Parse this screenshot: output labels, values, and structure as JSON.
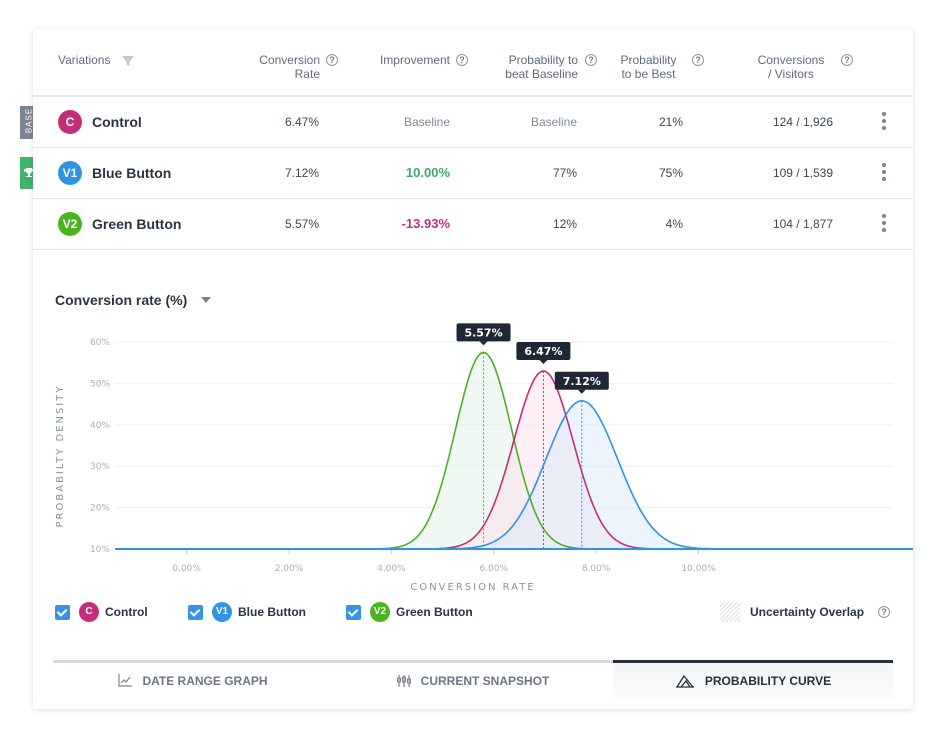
{
  "table": {
    "headers": {
      "variations": "Variations",
      "conversion_rate": [
        "Conversion",
        "Rate"
      ],
      "improvement": "Improvement",
      "prob_beat": [
        "Probability to",
        "beat Baseline"
      ],
      "prob_best": [
        "Probability",
        "to be Best"
      ],
      "conv_visitors": [
        "Conversions",
        "/ Visitors"
      ],
      "help_glyph": "?"
    },
    "rows": [
      {
        "badge": "C",
        "name": "Control",
        "color": "#c42e79",
        "side_tag": "BASE",
        "conversion_rate": "6.47%",
        "improvement": "Baseline",
        "improvement_kind": "muted",
        "prob_beat": "Baseline",
        "prob_beat_kind": "muted",
        "prob_best": "21%",
        "conv_visitors": "124 / 1,926"
      },
      {
        "badge": "V1",
        "name": "Blue Button",
        "color": "#2e95e6",
        "side_tag": "trophy",
        "conversion_rate": "7.12%",
        "improvement": "10.00%",
        "improvement_kind": "pos",
        "prob_beat": "77%",
        "prob_beat_kind": "",
        "prob_best": "75%",
        "conv_visitors": "109 / 1,539"
      },
      {
        "badge": "V2",
        "name": "Green Button",
        "color": "#4cb320",
        "side_tag": "",
        "conversion_rate": "5.57%",
        "improvement": "-13.93%",
        "improvement_kind": "neg",
        "prob_beat": "12%",
        "prob_beat_kind": "",
        "prob_best": "4%",
        "conv_visitors": "104 / 1,877"
      }
    ]
  },
  "chart_header": {
    "title": "Conversion rate (%)"
  },
  "chart_data": {
    "type": "area",
    "title": "Conversion rate (%)",
    "xlabel": "CONVERSION RATE",
    "ylabel": "PROBABILTY DENSITY",
    "x_ticks": [
      "0.00%",
      "2.00%",
      "4.00%",
      "6.00%",
      "8.00%",
      "10.00%"
    ],
    "x_tick_values": [
      0,
      2,
      4,
      6,
      8,
      10
    ],
    "y_ticks": [
      "10%",
      "20%",
      "30%",
      "40%",
      "50%",
      "60%"
    ],
    "y_tick_values": [
      10,
      20,
      30,
      40,
      50,
      60
    ],
    "xlim": [
      -1.4,
      13.8
    ],
    "ylim": [
      10,
      60
    ],
    "grid": true,
    "series": [
      {
        "name": "Green Button",
        "badge": "V2",
        "color": "#4cb320",
        "fill": "#e4f2ea",
        "mean": 5.8,
        "sd": 0.55,
        "peak": 57.5,
        "label": "5.57%"
      },
      {
        "name": "Control",
        "badge": "C",
        "color": "#c42e79",
        "fill": "#fbe2ec",
        "mean": 6.97,
        "sd": 0.58,
        "peak": 53,
        "label": "6.47%"
      },
      {
        "name": "Blue Button",
        "badge": "V1",
        "color": "#2e95e6",
        "fill": "#dcebfb",
        "mean": 7.72,
        "sd": 0.7,
        "peak": 45.8,
        "label": "7.12%"
      }
    ]
  },
  "legend": {
    "items": [
      {
        "badge": "C",
        "label": "Control",
        "color": "#c42e79",
        "checked": true
      },
      {
        "badge": "V1",
        "label": "Blue Button",
        "color": "#2e95e6",
        "checked": true
      },
      {
        "badge": "V2",
        "label": "Green Button",
        "color": "#4cb320",
        "checked": true
      }
    ],
    "overlap_label": "Uncertainty Overlap"
  },
  "tabs": [
    {
      "label": "DATE RANGE GRAPH",
      "icon": "line-chart-icon",
      "active": false
    },
    {
      "label": "CURRENT SNAPSHOT",
      "icon": "box-plot-icon",
      "active": false
    },
    {
      "label": "PROBABILITY CURVE",
      "icon": "bell-curve-icon",
      "active": true
    }
  ]
}
